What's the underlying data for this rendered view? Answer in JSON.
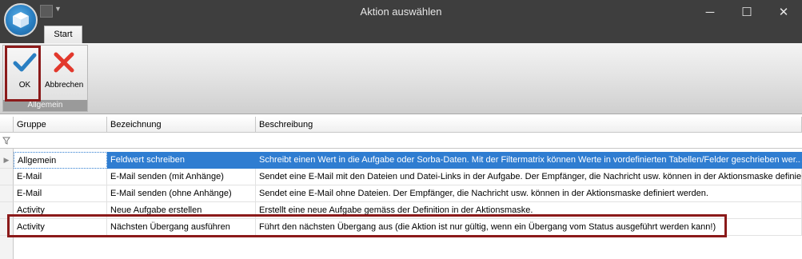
{
  "window": {
    "title": "Aktion auswählen",
    "controls": {
      "minimize": "─",
      "maximize": "☐",
      "close": "✕"
    }
  },
  "tabs": [
    {
      "label": "Start",
      "active": true
    }
  ],
  "ribbon": {
    "group_label": "Allgemein",
    "ok_label": "OK",
    "cancel_label": "Abbrechen"
  },
  "grid": {
    "columns": [
      "Gruppe",
      "Bezeichnung",
      "Beschreibung"
    ],
    "rows": [
      {
        "gruppe": "Allgemein",
        "bezeichnung": "Feldwert schreiben",
        "beschreibung": "Schreibt einen Wert in die Aufgabe oder Sorba-Daten. Mit der Filtermatrix können Werte in vordefinierten Tabellen/Felder geschrieben wer...",
        "selected": true
      },
      {
        "gruppe": "E-Mail",
        "bezeichnung": "E-Mail senden (mit Anhänge)",
        "beschreibung": "Sendet eine E-Mail mit den Dateien und Datei-Links in der Aufgabe. Der Empfänger, die Nachricht usw. können in der Aktionsmaske definie..."
      },
      {
        "gruppe": "E-Mail",
        "bezeichnung": "E-Mail senden (ohne Anhänge)",
        "beschreibung": "Sendet eine E-Mail ohne Dateien. Der Empfänger, die Nachricht usw. können in der Aktionsmaske definiert werden."
      },
      {
        "gruppe": "Activity",
        "bezeichnung": "Neue Aufgabe erstellen",
        "beschreibung": "Erstellt eine neue Aufgabe gemäss der Definition in der Aktionsmaske."
      },
      {
        "gruppe": "Activity",
        "bezeichnung": "Nächsten Übergang ausführen",
        "beschreibung": "Führt den nächsten Übergang aus (die Aktion ist nur gültig, wenn ein Übergang vom Status ausgeführt werden kann!)"
      }
    ]
  },
  "colors": {
    "selection": "#2f7dd1",
    "highlight": "#8b1a1a",
    "titlebar": "#3e3e3e"
  }
}
